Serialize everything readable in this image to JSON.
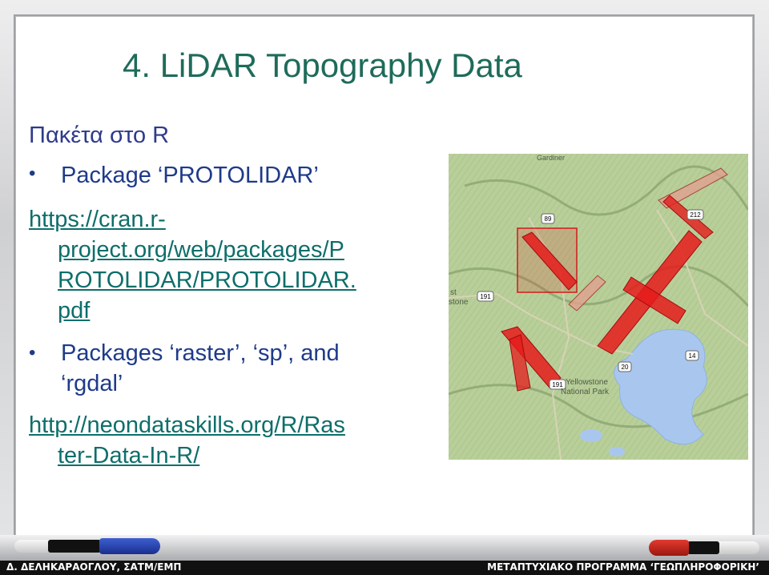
{
  "slide": {
    "title": "4. LiDAR Topography Data",
    "section_heading": "Πακέτα στο R",
    "bullets": [
      {
        "text": "Package ‘PROTOLIDAR’"
      },
      {
        "text": "Packages ‘raster’, ‘sp’, and",
        "continuation": "‘rgdal’"
      }
    ],
    "links": [
      {
        "lines": [
          "https://cran.r-",
          "project.org/web/packages/P",
          "ROTOLIDAR/PROTOLIDAR.",
          "pdf"
        ]
      },
      {
        "lines": [
          "http://neondataskills.org/R/Ras",
          "ter-Data-In-R/"
        ]
      }
    ]
  },
  "map": {
    "labels": {
      "park": "Yellowstone",
      "park2": "National Park",
      "partial_left": "st",
      "partial_left2": "stone",
      "route_89": "89",
      "route_191a": "191",
      "route_191b": "191",
      "route_20": "20",
      "route_14": "14",
      "route_212": "212",
      "town_top": "Gardiner"
    },
    "colors": {
      "terrain": "#b9cf9a",
      "lake": "#a9c7ee",
      "lidar_strip": "#e51b1b"
    }
  },
  "footer": {
    "left": "Δ. ΔΕΛΗΚΑΡΑΟΓΛΟΥ, ΣΑΤΜ/ΕΜΠ",
    "right": "ΜΕΤΑΠΤΥΧΙΑΚΟ ΠΡΟΓΡΑΜΜΑ ‘ΓΕΩΠΛΗΡΟΦΟΡΙΚΗ’"
  }
}
